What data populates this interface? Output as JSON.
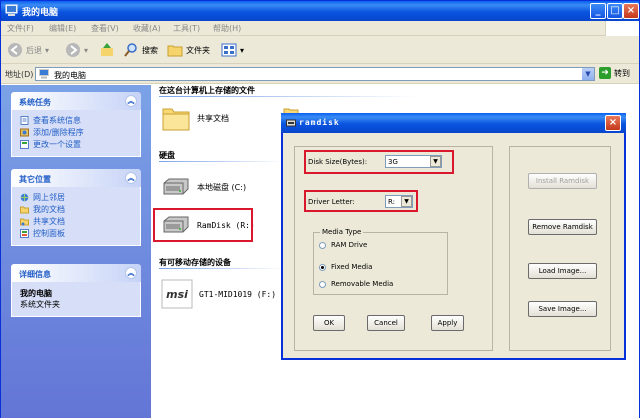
{
  "window": {
    "title": "我的电脑"
  },
  "menu": [
    "文件(F)",
    "编辑(E)",
    "查看(V)",
    "收藏(A)",
    "工具(T)",
    "帮助(H)"
  ],
  "toolbar": {
    "back": "后退",
    "search": "搜索",
    "folders": "文件夹"
  },
  "address": {
    "label": "地址(D)",
    "value": "我的电脑",
    "go": "转到"
  },
  "taskpane": {
    "system_tasks": {
      "title": "系统任务",
      "items": [
        "查看系统信息",
        "添加/删除程序",
        "更改一个设置"
      ]
    },
    "other_places": {
      "title": "其它位置",
      "items": [
        "网上邻居",
        "我的文档",
        "共享文档",
        "控制面板"
      ]
    },
    "details": {
      "title": "详细信息",
      "name": "我的电脑",
      "type": "系统文件夹"
    }
  },
  "content": {
    "section_files": "在这台计算机上存储的文件",
    "shared_docs": "共享文档",
    "section_disks": "硬盘",
    "local_disk": "本地磁盘 (C:)",
    "ramdisk": "RamDisk (R:)",
    "section_removable": "有可移动存储的设备",
    "usb_device": "GT1-MID1019 (F:)",
    "usb_brand": "msi"
  },
  "dialog": {
    "title": "ramdisk",
    "disk_size_label": "Disk Size(Bytes):",
    "disk_size_value": "3G",
    "driver_letter_label": "Driver Letter:",
    "driver_letter_value": "R:",
    "media_type_label": "Media Type",
    "media_options": [
      "RAM Drive",
      "Fixed Media",
      "Removable Media"
    ],
    "media_selected": "Fixed Media",
    "ok": "OK",
    "cancel": "Cancel",
    "apply": "Apply",
    "install": "Install Ramdisk",
    "remove": "Remove Ramdisk",
    "load": "Load Image...",
    "save": "Save Image..."
  },
  "colors": {
    "highlight_box": "#d9182e",
    "titlebar": "#0a54df",
    "taskpane": "#6f8fdf"
  }
}
